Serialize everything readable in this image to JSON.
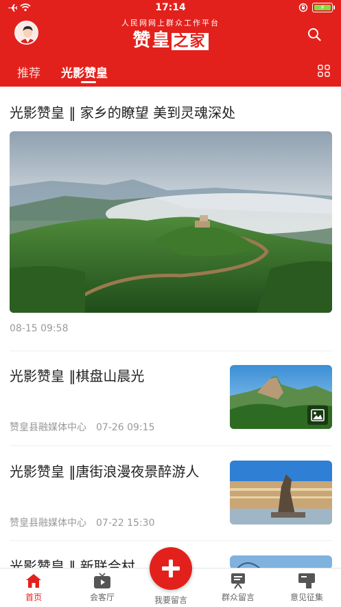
{
  "status_bar": {
    "time": "17:14"
  },
  "header": {
    "brand_subtitle": "人民网网上群众工作平台",
    "brand_title_main": "赞皇",
    "brand_title_boxed": "之家"
  },
  "tabs": [
    {
      "label": "推荐"
    },
    {
      "label": "光影赞皇"
    }
  ],
  "featured": {
    "title": "光影赞皇 ‖ 家乡的瞭望 美到灵魂深处",
    "time": "08-15 09:58"
  },
  "articles": [
    {
      "title": "光影赞皇 ‖棋盘山晨光",
      "source": "赞皇县融媒体中心",
      "time": "07-26 09:15"
    },
    {
      "title": "光影赞皇 ‖唐街浪漫夜景醉游人",
      "source": "赞皇县融媒体中心",
      "time": "07-22 15:30"
    },
    {
      "title": "光影赞皇 ‖ 新联合村……助"
    }
  ],
  "bottom_nav": [
    {
      "label": "首页",
      "icon": "home-icon"
    },
    {
      "label": "会客厅",
      "icon": "tv-play-icon"
    },
    {
      "label": "我要留言",
      "icon": "plus-icon"
    },
    {
      "label": "群众留言",
      "icon": "board-icon"
    },
    {
      "label": "意见征集",
      "icon": "feedback-icon"
    }
  ],
  "colors": {
    "brand_red": "#e3211c",
    "meta_gray": "#999999"
  }
}
